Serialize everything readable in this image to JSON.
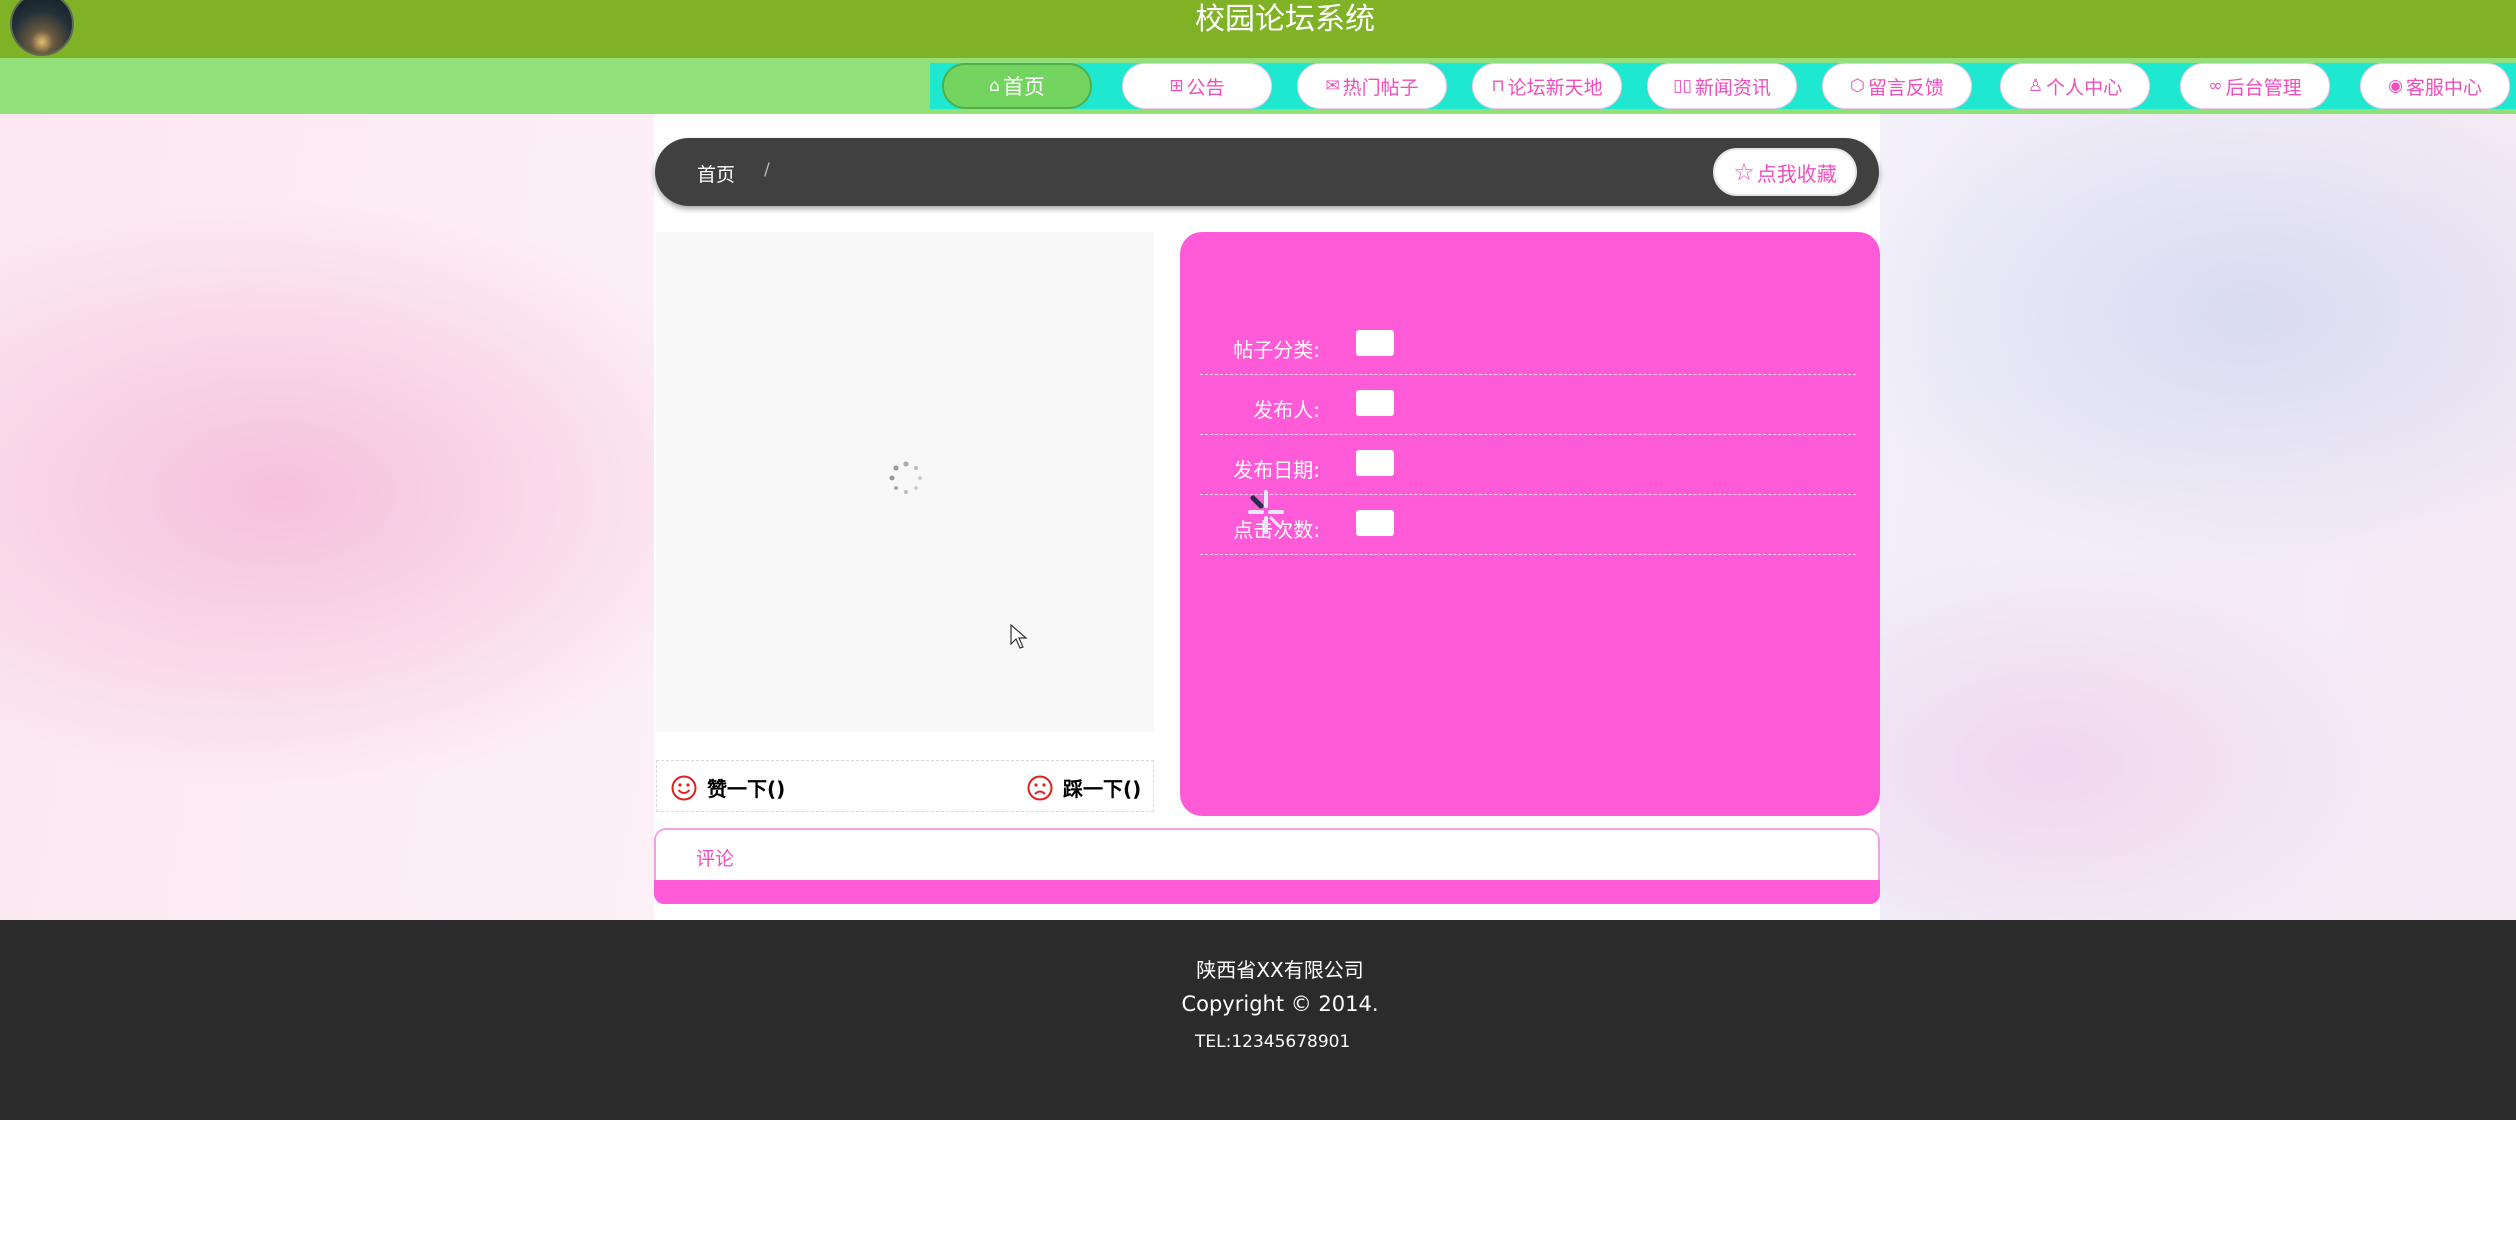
{
  "header": {
    "title": "校园论坛系统"
  },
  "nav": {
    "items": [
      {
        "label": "首页",
        "icon": "home-icon",
        "active": true
      },
      {
        "label": "公告",
        "icon": "gift-icon"
      },
      {
        "label": "热门帖子",
        "icon": "mail-icon"
      },
      {
        "label": "论坛新天地",
        "icon": "shop-icon"
      },
      {
        "label": "新闻资讯",
        "icon": "news-icon"
      },
      {
        "label": "留言反馈",
        "icon": "box-icon"
      },
      {
        "label": "个人中心",
        "icon": "user-icon"
      },
      {
        "label": "后台管理",
        "icon": "link-icon"
      },
      {
        "label": "客服中心",
        "icon": "chat-icon"
      }
    ]
  },
  "breadcrumb": {
    "home": "首页",
    "separator": "/"
  },
  "favorite": {
    "label": "点我收藏"
  },
  "votes": {
    "like": "赞一下()",
    "dislike": "踩一下()"
  },
  "info": {
    "rows": [
      {
        "label": "帖子分类:"
      },
      {
        "label": "发布人:"
      },
      {
        "label": "发布日期:"
      },
      {
        "label": "点击次数:"
      }
    ]
  },
  "comments": {
    "tab": "评论"
  },
  "footer": {
    "company": "陕西省XX有限公司",
    "copyright": "Copyright © 2014.",
    "tel": "TEL:12345678901"
  },
  "colors": {
    "header": "#80b226",
    "nav": "#92e07a",
    "accent": "#ff5ad8",
    "footer": "#2b2b2b"
  }
}
